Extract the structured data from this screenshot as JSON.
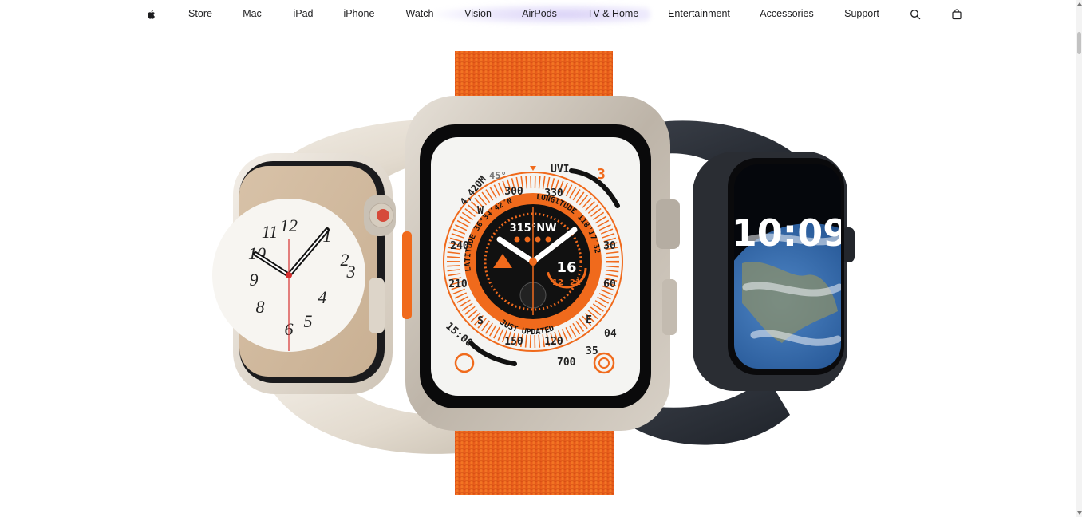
{
  "nav": {
    "brand_icon": "apple-logo-icon",
    "items": [
      {
        "label": "Store"
      },
      {
        "label": "Mac"
      },
      {
        "label": "iPad"
      },
      {
        "label": "iPhone"
      },
      {
        "label": "Watch"
      },
      {
        "label": "Vision"
      },
      {
        "label": "AirPods"
      },
      {
        "label": "TV & Home"
      },
      {
        "label": "Entertainment"
      },
      {
        "label": "Accessories"
      },
      {
        "label": "Support"
      }
    ],
    "search_icon": "search-icon",
    "bag_icon": "shopping-bag-icon"
  },
  "hero": {
    "ultra_face": {
      "altitude": "4,420M",
      "incline": "45°",
      "uvi_label": "UVI",
      "uvi_value": "3",
      "ring_labels": [
        "300",
        "330",
        "30",
        "60",
        "E",
        "120",
        "150",
        "210",
        "240",
        "W",
        "S"
      ],
      "latitude_text": "LATITUDE 36°34′42″N",
      "longitude_text": "LONGITUDE 118°17′32″W",
      "heading": "315°NW",
      "date_number": "16",
      "date_low": "12",
      "date_high": "21",
      "updated_text": "JUST UPDATED",
      "time_text": "15:00",
      "elevation_bottom": "700",
      "elevation_right": "35",
      "elevation_far_right": "04"
    },
    "right_watch": {
      "time": "10:09"
    },
    "colors": {
      "alpine_orange": "#f06a1c",
      "starlight_band": "#e7e0d6",
      "midnight_band": "#2b2f37",
      "titanium": "#cfc8be"
    }
  }
}
